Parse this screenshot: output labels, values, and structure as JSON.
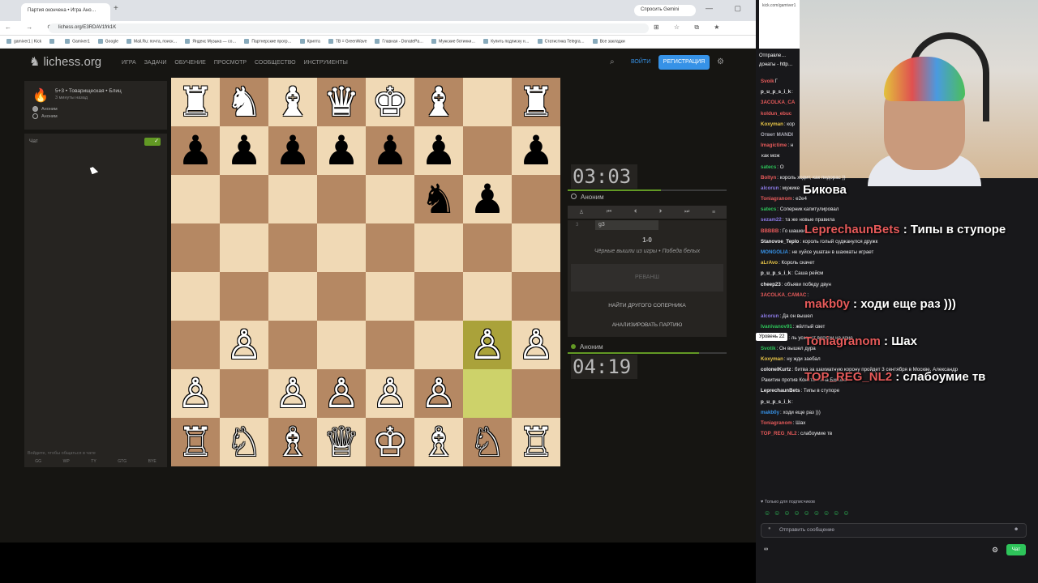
{
  "browser": {
    "tab_title": "Партия окончена • Игра Ано…",
    "new_tab": "+",
    "gemini": "Спросить Gemini",
    "window_controls": "— ▢ ✕",
    "nav_buttons": "← → ⟳",
    "url": "lichess.org/E3RDAV1frk1K",
    "addr_icons": "⊞ ☆ ⧉ ★",
    "bookmarks": [
      "gamiver1 | Kick",
      "",
      "Gamiver1",
      "Google",
      "Mail.Ru: почта, поиск…",
      "Яндекс Музыка — со…",
      "Партнерские прогр…",
      "Крипта",
      "TB = GreenWave",
      "Главная - DonatePa…",
      "Мужские ботинки…",
      "Купить подписку н…",
      "Статистика Telegra…",
      "Все закладки"
    ]
  },
  "lichess": {
    "logo": "lichess.org",
    "nav": [
      "ИГРА",
      "ЗАДАЧИ",
      "ОБУЧЕНИЕ",
      "ПРОСМОТР",
      "СООБЩЕСТВО",
      "ИНСТРУМЕНТЫ"
    ],
    "search_icon": "⌕",
    "login": "ВОЙТИ",
    "register": "РЕГИСТРАЦИЯ",
    "gear_icon": "⚙",
    "game": {
      "fire_icon": "🔥",
      "title": "5+3 • Товарищеская • Блиц",
      "time_ago": "3 минуты назад",
      "player_white": "Аноним",
      "player_black": "Аноним"
    },
    "chat": {
      "label": "Чат",
      "toggle": "✓",
      "placeholder": "Войдите, чтобы общаться в чате",
      "quick": [
        "GG",
        "WP",
        "TY",
        "GTG",
        "BYE"
      ]
    },
    "board": [
      [
        "♜",
        "♞",
        "♝",
        "♛",
        "♚",
        "♝",
        "",
        "♜"
      ],
      [
        "♟",
        "♟",
        "♟",
        "♟",
        "♟",
        "♟",
        "",
        "♟"
      ],
      [
        "",
        "",
        "",
        "",
        "",
        "♞",
        "♟",
        ""
      ],
      [
        "",
        "",
        "",
        "",
        "",
        "",
        "",
        ""
      ],
      [
        "",
        "",
        "",
        "",
        "",
        "",
        "",
        ""
      ],
      [
        "",
        "♙",
        "",
        "",
        "",
        "",
        "♙",
        "♙"
      ],
      [
        "♙",
        "",
        "♙",
        "♙",
        "♙",
        "♙",
        "",
        ""
      ],
      [
        "♖",
        "♘",
        "♗",
        "♕",
        "♔",
        "♗",
        "♘",
        "♖"
      ]
    ],
    "board_colors": [
      [
        "w",
        "w",
        "w",
        "w",
        "w",
        "w",
        "w",
        "w"
      ],
      [
        "b",
        "b",
        "b",
        "b",
        "b",
        "b",
        "b",
        "b"
      ],
      [
        "",
        "",
        "",
        "",
        "",
        "b",
        "b",
        ""
      ],
      [
        "",
        "",
        "",
        "",
        "",
        "",
        "",
        ""
      ],
      [
        "",
        "",
        "",
        "",
        "",
        "",
        "",
        ""
      ],
      [
        "",
        "w",
        "",
        "",
        "",
        "",
        "w",
        "w"
      ],
      [
        "w",
        "",
        "w",
        "w",
        "w",
        "w",
        "",
        ""
      ],
      [
        "w",
        "w",
        "w",
        "w",
        "w",
        "w",
        "w",
        "w"
      ]
    ],
    "highlight": {
      "from": "g2",
      "to": "g3"
    },
    "clock_top": "03:03",
    "clock_bottom": "04:19",
    "player_top": "Аноним",
    "player_bottom": "Аноним",
    "move_tools": [
      "♙",
      "⏮",
      "⏴",
      "⏵",
      "⏭",
      "≡"
    ],
    "move_number": "3",
    "move_san": "g3",
    "score": "1-0",
    "result_text": "Чёрные вышли из игры • Победа белых",
    "rematch": "РЕВАНШ",
    "new_opponent": "НАЙТИ ДРУГОГО СОПЕРНИКА",
    "analyze": "АНАЛИЗИРОВАТЬ ПАРТИЮ"
  },
  "stream": {
    "mini_header": "kick.com/gamiver1",
    "announce": "Отправле… донаты - http…",
    "chat": [
      {
        "u": "Svoik",
        "c": "#e65a5a",
        "t": "Г"
      },
      {
        "u": "p_u_p_s_i_k",
        "c": "#efeff1",
        "t": ":"
      },
      {
        "u": "3ACOLKA_CA",
        "c": "#e65a5a",
        "t": ""
      },
      {
        "u": "koldun_ebuc",
        "c": "#e65a5a",
        "t": ""
      },
      {
        "u": "Koxyman",
        "c": "#e8c547",
        "t": ": кор"
      },
      {
        "u": "Ответ MANDI",
        "c": "#adadb8",
        "t": ""
      },
      {
        "u": "Imagictime",
        "c": "#e65a5a",
        "t": ": н"
      },
      {
        "u": "",
        "c": "#efeff1",
        "t": "как мож"
      },
      {
        "u": "satecs",
        "c": "#2ec45a",
        "t": ": О"
      },
      {
        "u": "Boltyn",
        "c": "#e65a5a",
        "t": ": король ходит, как пидорас ))"
      },
      {
        "u": "alcorun",
        "c": "#8c7ae6",
        "t": ": мужике"
      },
      {
        "u": "Toniagranom",
        "c": "#e65a5a",
        "t": ": е2е4"
      },
      {
        "u": "satecs",
        "c": "#2ec45a",
        "t": ": Соперник капитулировал"
      },
      {
        "u": "sezam22",
        "c": "#8c7ae6",
        "t": ": та же новые правила"
      },
      {
        "u": "BBBBB",
        "c": "#e65a5a",
        "t": ": Го шашки"
      },
      {
        "u": "Stanovoe_Teplo",
        "c": "#efeff1",
        "t": ": король голый суджанулся дружк"
      },
      {
        "u": "MONGOLIA",
        "c": "#3692e7",
        "t": ": не хуйсе ушатан в шахматы играет"
      },
      {
        "u": "aLrAvo",
        "c": "#e8c547",
        "t": ": Король скачет"
      },
      {
        "u": "p_u_p_s_i_k",
        "c": "#efeff1",
        "t": ": Саша рейсм"
      },
      {
        "u": "cheep23",
        "c": "#efeff1",
        "t": ": объяви победу двун"
      },
      {
        "u": "3ACOLKA_CAMAC",
        "c": "#e65a5a",
        "t": ":"
      },
      {
        "u": "",
        "c": "#efeff1",
        "t": ""
      },
      {
        "u": "alcorun",
        "c": "#8c7ae6",
        "t": ": Да он вышел"
      },
      {
        "u": "Ivanivanov91",
        "c": "#2ec45a",
        "t": ": жёлтый свет"
      },
      {
        "u": "FallnTheSh",
        "c": "#e65a5a",
        "t": ": ль ускачет верхом на коне"
      },
      {
        "u": "Svotik",
        "c": "#2ec45a",
        "t": ": Он вышел дура"
      },
      {
        "u": "Koxyman",
        "c": "#e8c547",
        "t": ": ну жди заебал"
      },
      {
        "u": "colonelKurtz",
        "c": "#efeff1",
        "t": ": битва за шахматную корону пройдет 3 сентября в Москве. Александр"
      },
      {
        "u": "",
        "c": "#efeff1",
        "t": "Ракитин против Константина Бикова"
      },
      {
        "u": "LeprechaunBets",
        "c": "#efeff1",
        "t": ": Типы в ступоре"
      },
      {
        "u": "p_u_p_s_i_k",
        "c": "#efeff1",
        "t": ":"
      },
      {
        "u": "makb0y",
        "c": "#3692e7",
        "t": ": ходи еще раз )))"
      },
      {
        "u": "Toniagranom",
        "c": "#e65a5a",
        "t": ": Шах"
      },
      {
        "u": "TOP_REG_NL2",
        "c": "#e65a5a",
        "t": ": слабоумие тв"
      }
    ],
    "tts": [
      {
        "u": "",
        "t": "Бикова"
      },
      {
        "u": "LeprechaunBets",
        "t": " : Типы в ступоре"
      },
      {
        "u": "makb0y",
        "t": " : ходи еще раз )))"
      },
      {
        "u": "Toniagranom",
        "t": " : Шах"
      },
      {
        "u": "TOP_REG_NL2",
        "t": " : слабоумие тв"
      }
    ],
    "tooltip": "Уровень 22",
    "subs_only": "♥ Только для подписчиков",
    "emotes": "☺☺☺☺☺☺☺☺☺",
    "send_placeholder": "Отправить сообщение",
    "smiley_icon": "☻",
    "points": "∞",
    "gear_icon": "⚙",
    "chat_button": "Чат"
  }
}
